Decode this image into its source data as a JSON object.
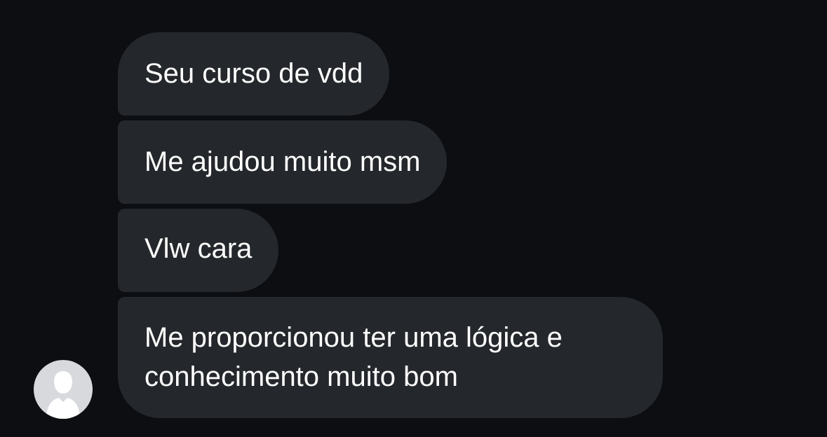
{
  "conversation": {
    "messages": [
      {
        "text": "Seu curso de vdd"
      },
      {
        "text": "Me ajudou muito msm"
      },
      {
        "text": "Vlw cara"
      },
      {
        "lines": [
          "Me proporcionou ter uma lógica e",
          "conhecimento muito bom"
        ]
      }
    ],
    "sender_avatar_icon": "default-person-silhouette-icon"
  },
  "colors": {
    "background": "#0c0e12",
    "bubble": "#24272b",
    "text": "#ffffff",
    "avatar_bg": "#d7d9dd",
    "avatar_silhouette": "#ffffff"
  }
}
